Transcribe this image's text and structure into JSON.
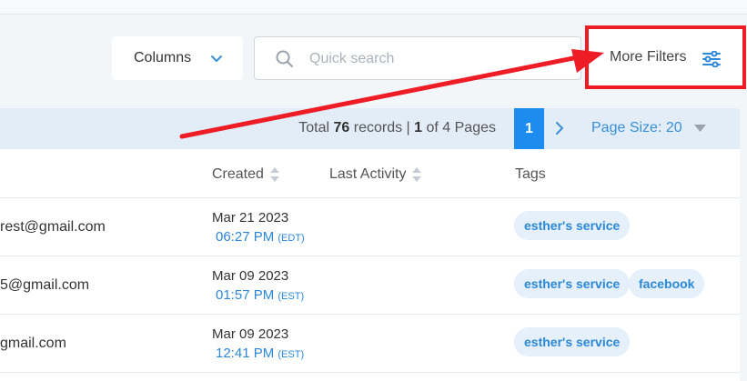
{
  "toolbar": {
    "columns_label": "Columns",
    "search_placeholder": "Quick search",
    "more_filters_label": "More Filters"
  },
  "pager": {
    "total_prefix": "Total ",
    "total_count": "76",
    "total_mid": " records | ",
    "current_page": "1",
    "of_pages": " of 4 Pages",
    "active_page": "1",
    "page_size_label": "Page Size: 20"
  },
  "table": {
    "headers": {
      "created": "Created",
      "last_activity": "Last Activity",
      "tags": "Tags"
    },
    "rows": [
      {
        "email": "rest@gmail.com",
        "date": "Mar 21 2023",
        "time": "06:27 PM",
        "tz": "(EDT)",
        "tags": [
          "esther's service"
        ]
      },
      {
        "email": "5@gmail.com",
        "date": "Mar 09 2023",
        "time": "01:57 PM",
        "tz": "(EST)",
        "tags": [
          "esther's service",
          "facebook"
        ]
      },
      {
        "email": "gmail.com",
        "date": "Mar 09 2023",
        "time": "12:41 PM",
        "tz": "(EST)",
        "tags": [
          "esther's service"
        ]
      }
    ]
  },
  "colors": {
    "accent": "#1d8cf0",
    "link": "#2b87d8",
    "highlight": "#ee1c24",
    "tag_bg": "#e5f0fb"
  },
  "icons": [
    "chevron-down-icon",
    "search-icon",
    "filter-sliders-icon",
    "chevron-right-icon",
    "caret-down-icon",
    "sort-icon"
  ]
}
